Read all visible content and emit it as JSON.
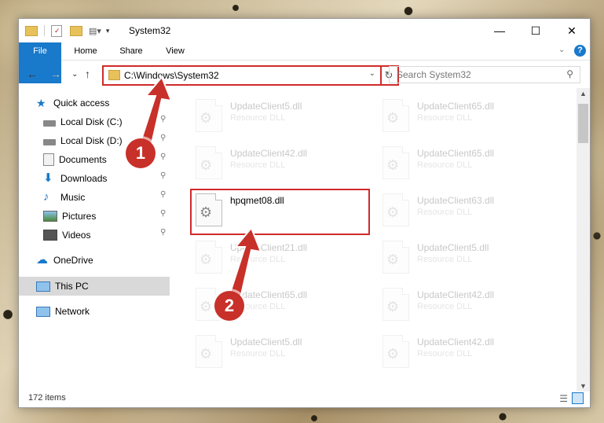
{
  "window": {
    "title": "System32"
  },
  "ribbon": {
    "tabs": [
      "File",
      "Home",
      "Share",
      "View"
    ]
  },
  "address": {
    "path": "C:\\Windows\\System32"
  },
  "search": {
    "placeholder": "Search System32"
  },
  "nav": {
    "items": [
      {
        "label": "Quick access",
        "icon": "star-icon",
        "pinned": false
      },
      {
        "label": "Local Disk (C:)",
        "icon": "drive-icon",
        "pinned": true
      },
      {
        "label": "Local Disk (D:)",
        "icon": "drive-icon",
        "pinned": true
      },
      {
        "label": "Documents",
        "icon": "documents-icon",
        "pinned": true
      },
      {
        "label": "Downloads",
        "icon": "download-icon",
        "pinned": true
      },
      {
        "label": "Music",
        "icon": "music-icon",
        "pinned": true
      },
      {
        "label": "Pictures",
        "icon": "pictures-icon",
        "pinned": true
      },
      {
        "label": "Videos",
        "icon": "videos-icon",
        "pinned": true
      },
      {
        "label": "OneDrive",
        "icon": "cloud-icon",
        "pinned": false
      },
      {
        "label": "This PC",
        "icon": "computer-icon",
        "pinned": false
      },
      {
        "label": "Network",
        "icon": "network-icon",
        "pinned": false
      }
    ]
  },
  "files": {
    "left": [
      {
        "name": "UpdateClient5.dll",
        "type": "Resource DLL"
      },
      {
        "name": "UpdateClient42.dll",
        "type": "Resource DLL"
      },
      {
        "name": "hpqmet08.dll",
        "type": ""
      },
      {
        "name": "UpdateClient21.dll",
        "type": "Resource DLL"
      },
      {
        "name": "UpdateClient65.dll",
        "type": "Resource DLL"
      },
      {
        "name": "UpdateClient5.dll",
        "type": "Resource DLL"
      }
    ],
    "right": [
      {
        "name": "UpdateClient65.dll",
        "type": "Resource DLL"
      },
      {
        "name": "UpdateClient65.dll",
        "type": "Resource DLL"
      },
      {
        "name": "UpdateClient63.dll",
        "type": "Resource DLL"
      },
      {
        "name": "UpdateClient5.dll",
        "type": "Resource DLL"
      },
      {
        "name": "UpdateClient42.dll",
        "type": "Resource DLL"
      },
      {
        "name": "UpdateClient42.dll",
        "type": "Resource DLL"
      }
    ]
  },
  "status": {
    "count": "172 items"
  },
  "annotations": {
    "badge1": "1",
    "badge2": "2"
  },
  "colors": {
    "accent": "#1979ca",
    "highlight": "#d02a2a"
  }
}
